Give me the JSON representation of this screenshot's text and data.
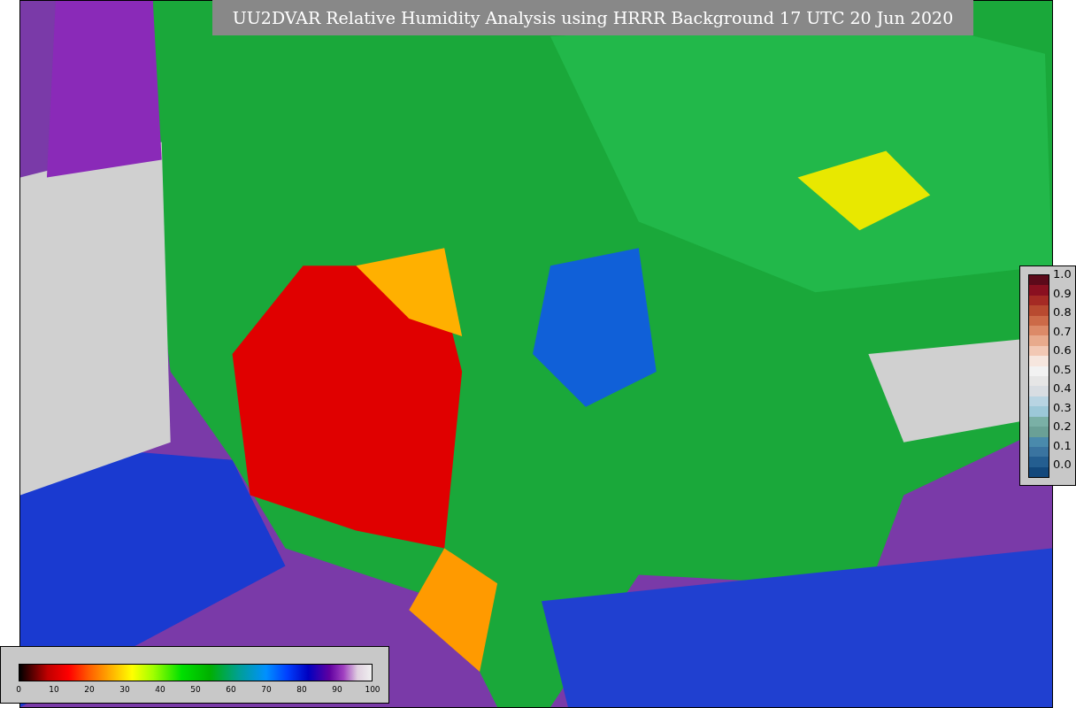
{
  "title": "UU2DVAR Relative Humidity Analysis using HRRR Background 17 UTC 20 Jun 2020",
  "side_colorbar": {
    "ticks": [
      "1.0",
      "0.9",
      "0.8",
      "0.7",
      "0.6",
      "0.5",
      "0.4",
      "0.3",
      "0.2",
      "0.1",
      "0.0"
    ]
  },
  "bottom_colorbar": {
    "ticks": [
      "0",
      "10",
      "20",
      "30",
      "40",
      "50",
      "60",
      "70",
      "80",
      "90",
      "100"
    ]
  }
}
